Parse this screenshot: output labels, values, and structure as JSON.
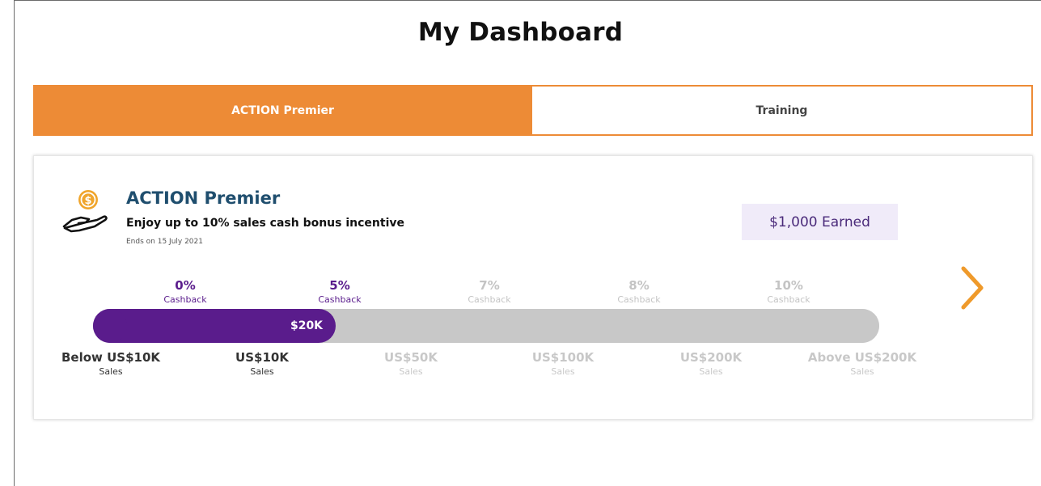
{
  "page": {
    "title": "My Dashboard"
  },
  "tabs": [
    {
      "label": "ACTION Premier",
      "active": true
    },
    {
      "label": "Training",
      "active": false
    }
  ],
  "program": {
    "icon": "hand-coin-icon",
    "title": "ACTION Premier",
    "subtitle": "Enjoy up to 10% sales cash bonus incentive",
    "end_date": "Ends on 15 July 2021",
    "earned": "$1,000 Earned",
    "next_icon": "chevron-right-icon"
  },
  "progress": {
    "current_label": "$20K",
    "current_level_index": 1,
    "tiers": [
      {
        "pct": "0%",
        "label": "Cashback",
        "achieved": true
      },
      {
        "pct": "5%",
        "label": "Cashback",
        "achieved": true
      },
      {
        "pct": "7%",
        "label": "Cashback",
        "achieved": false
      },
      {
        "pct": "8%",
        "label": "Cashback",
        "achieved": false
      },
      {
        "pct": "10%",
        "label": "Cashback",
        "achieved": false
      }
    ],
    "levels": [
      {
        "amount": "Below US$10K",
        "label": "Sales",
        "achieved": true
      },
      {
        "amount": "US$10K",
        "label": "Sales",
        "achieved": true
      },
      {
        "amount": "US$50K",
        "label": "Sales",
        "achieved": false
      },
      {
        "amount": "US$100K",
        "label": "Sales",
        "achieved": false
      },
      {
        "amount": "US$200K",
        "label": "Sales",
        "achieved": false
      },
      {
        "amount": "Above US$200K",
        "label": "Sales",
        "achieved": false
      }
    ]
  },
  "colors": {
    "accent": "#ed8b36",
    "progress": "#5a1c8c",
    "inactive": "#c8c8c8",
    "title": "#1f4e6e",
    "earned_bg": "#f0ebf9"
  }
}
